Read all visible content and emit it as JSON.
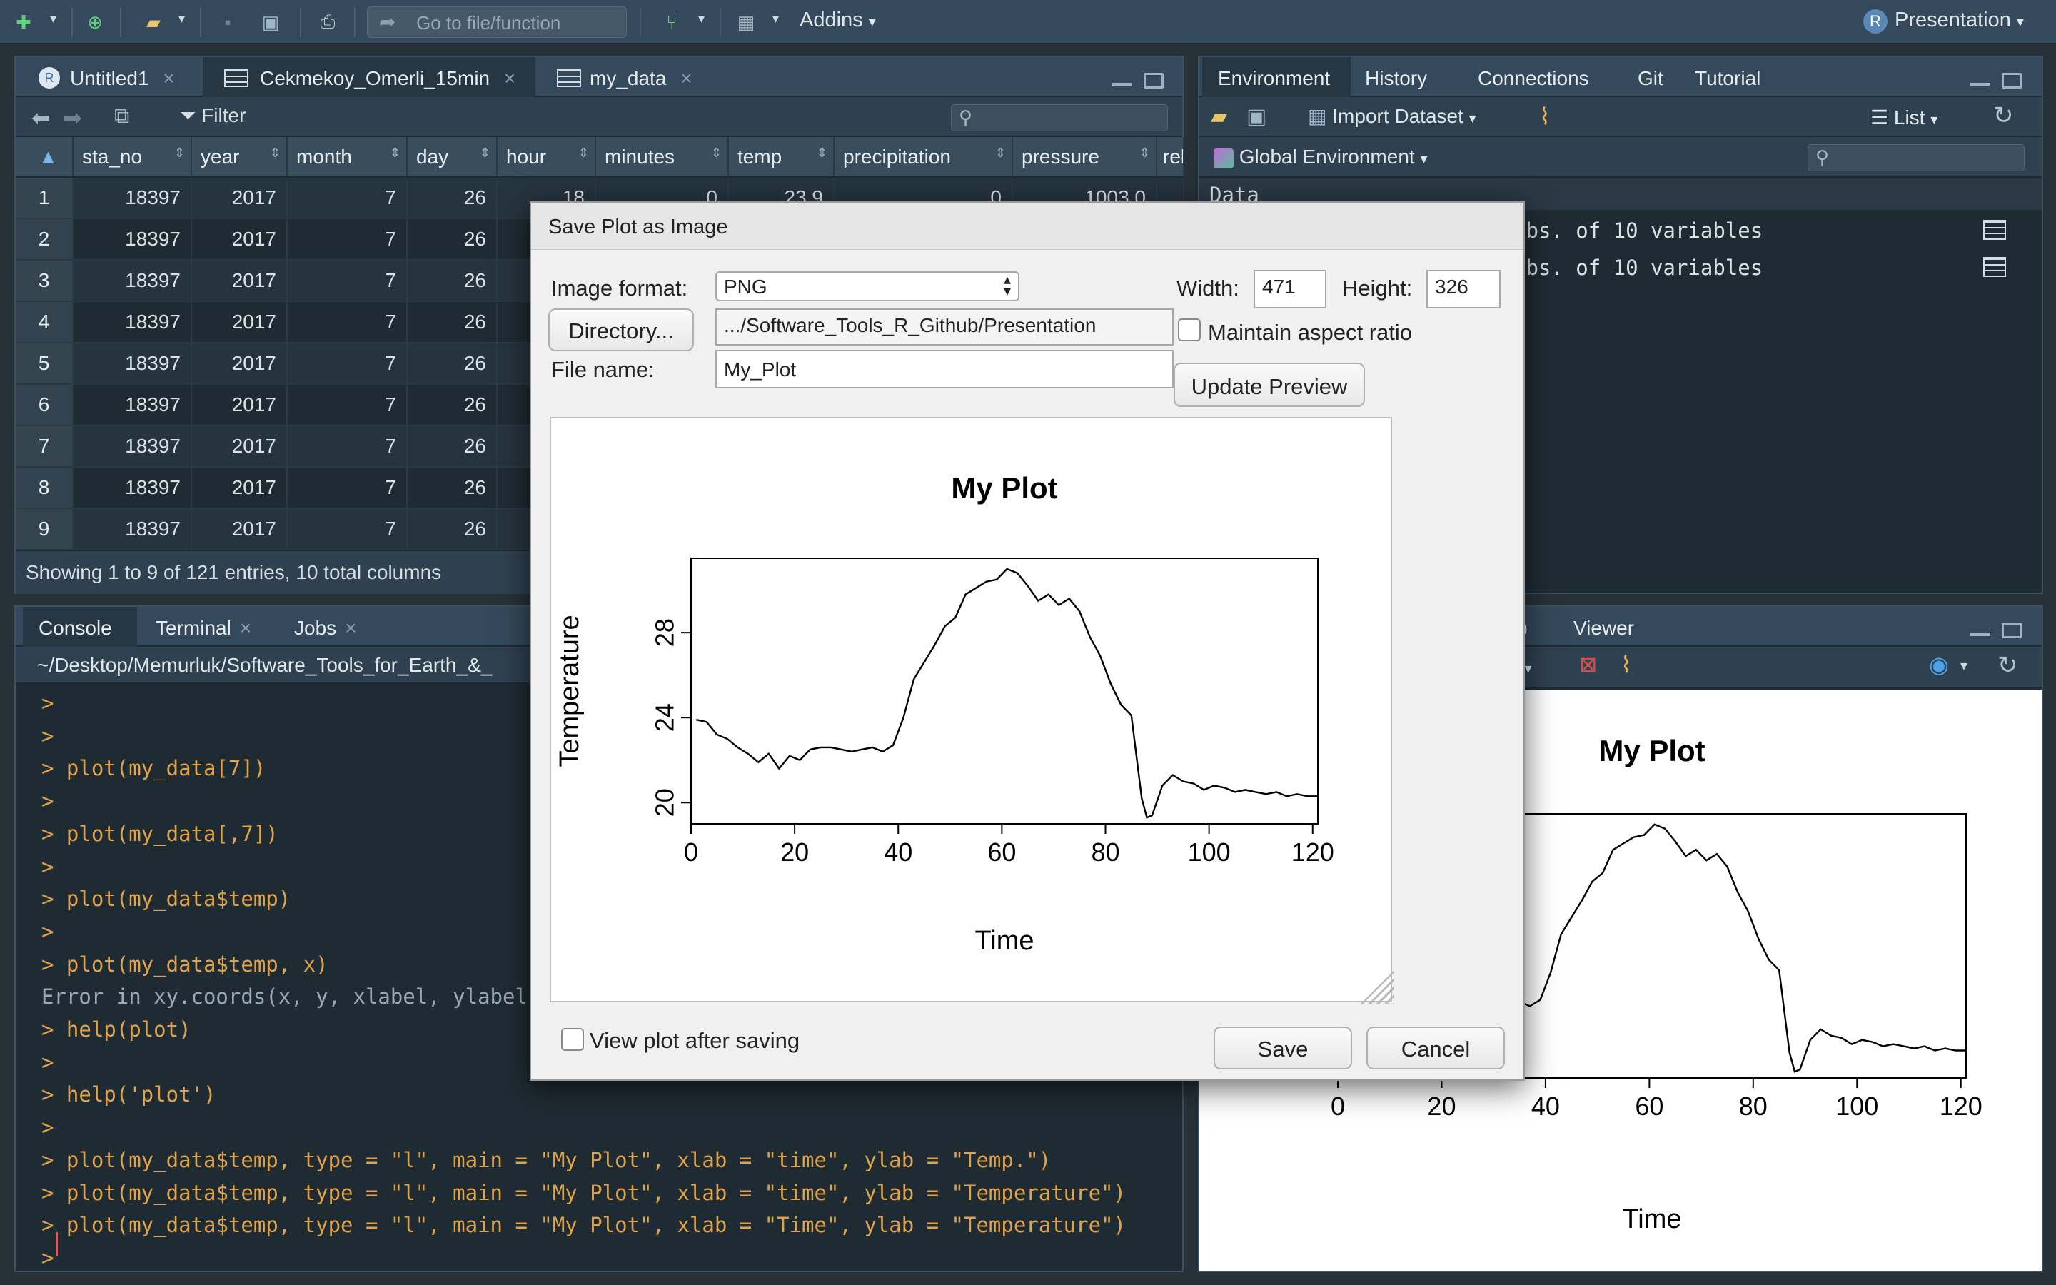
{
  "toolbar": {
    "goto_placeholder": "Go to file/function",
    "addins_label": "Addins",
    "project_label": "Presentation"
  },
  "source_pane": {
    "tabs": [
      {
        "label": "Untitled1"
      },
      {
        "label": "Cekmekoy_Omerli_15min"
      },
      {
        "label": "my_data"
      }
    ],
    "filter_label": "Filter",
    "columns": [
      "sta_no",
      "year",
      "month",
      "day",
      "hour",
      "minutes",
      "temp",
      "precipitation",
      "pressure",
      "rel"
    ],
    "rows": [
      {
        "n": "1",
        "sta_no": "18397",
        "year": "2017",
        "month": "7",
        "day": "26",
        "hour": "18",
        "minutes": "0",
        "temp": "23.9",
        "precipitation": "0",
        "pressure": "1003.0"
      },
      {
        "n": "2",
        "sta_no": "18397",
        "year": "2017",
        "month": "7",
        "day": "26"
      },
      {
        "n": "3",
        "sta_no": "18397",
        "year": "2017",
        "month": "7",
        "day": "26"
      },
      {
        "n": "4",
        "sta_no": "18397",
        "year": "2017",
        "month": "7",
        "day": "26"
      },
      {
        "n": "5",
        "sta_no": "18397",
        "year": "2017",
        "month": "7",
        "day": "26"
      },
      {
        "n": "6",
        "sta_no": "18397",
        "year": "2017",
        "month": "7",
        "day": "26"
      },
      {
        "n": "7",
        "sta_no": "18397",
        "year": "2017",
        "month": "7",
        "day": "26"
      },
      {
        "n": "8",
        "sta_no": "18397",
        "year": "2017",
        "month": "7",
        "day": "26"
      },
      {
        "n": "9",
        "sta_no": "18397",
        "year": "2017",
        "month": "7",
        "day": "26"
      }
    ],
    "status": "Showing 1 to 9 of 121 entries, 10 total columns"
  },
  "console_pane": {
    "tabs": [
      {
        "label": "Console"
      },
      {
        "label": "Terminal"
      },
      {
        "label": "Jobs"
      }
    ],
    "path": "~/Desktop/Memurluk/Software_Tools_for_Earth_&_",
    "lines": [
      {
        "p": ">",
        "c": "",
        "t": "cmd"
      },
      {
        "p": ">",
        "c": "",
        "t": "cmd"
      },
      {
        "p": ">",
        "c": " plot(my_data[7])",
        "t": "cmd"
      },
      {
        "p": ">",
        "c": "",
        "t": "cmd"
      },
      {
        "p": ">",
        "c": " plot(my_data[,7])",
        "t": "cmd"
      },
      {
        "p": ">",
        "c": "",
        "t": "cmd"
      },
      {
        "p": ">",
        "c": " plot(my_data$temp)",
        "t": "cmd"
      },
      {
        "p": ">",
        "c": "",
        "t": "cmd"
      },
      {
        "p": ">",
        "c": " plot(my_data$temp, x)",
        "t": "cmd"
      },
      {
        "p": "",
        "c": "Error in xy.coords(x, y, xlabel, ylabel",
        "t": "err"
      },
      {
        "p": ">",
        "c": " help(plot)",
        "t": "cmd"
      },
      {
        "p": ">",
        "c": "",
        "t": "cmd"
      },
      {
        "p": ">",
        "c": " help('plot')",
        "t": "cmd"
      },
      {
        "p": ">",
        "c": "",
        "t": "cmd"
      },
      {
        "p": ">",
        "c": " plot(my_data$temp, type = \"l\", main = \"My Plot\", xlab = \"time\", ylab = \"Temp.\")",
        "t": "cmd"
      },
      {
        "p": ">",
        "c": " plot(my_data$temp, type = \"l\", main = \"My Plot\", xlab = \"time\", ylab = \"Temperature\")",
        "t": "cmd"
      },
      {
        "p": ">",
        "c": " plot(my_data$temp, type = \"l\", main = \"My Plot\", xlab = \"Time\", ylab = \"Temperature\")",
        "t": "cmd"
      },
      {
        "p": ">",
        "c": "",
        "t": "cmd"
      },
      {
        "p": ">",
        "c": "",
        "t": "cmd"
      }
    ]
  },
  "env_pane": {
    "tabs": [
      {
        "label": "Environment"
      },
      {
        "label": "History"
      },
      {
        "label": "Connections"
      },
      {
        "label": "Git"
      },
      {
        "label": "Tutorial"
      }
    ],
    "import_label": "Import Dataset",
    "list_label": "List",
    "scope_label": "Global Environment",
    "section_label": "Data",
    "vars": [
      {
        "desc": "obs. of 10 variables"
      },
      {
        "desc": "obs. of 10 variables"
      }
    ]
  },
  "viewer_pane": {
    "tabs": [
      {
        "label": "p"
      },
      {
        "label": "Viewer"
      }
    ],
    "export_label": "t"
  },
  "dialog": {
    "title": "Save Plot as Image",
    "image_format_label": "Image format:",
    "image_format_value": "PNG",
    "width_label": "Width:",
    "width_value": "471",
    "height_label": "Height:",
    "height_value": "326",
    "directory_button": "Directory...",
    "directory_path": ".../Software_Tools_R_Github/Presentation",
    "aspect_label": "Maintain aspect ratio",
    "filename_label": "File name:",
    "filename_value": "My_Plot",
    "update_button": "Update Preview",
    "view_after_label": "View plot after saving",
    "save_button": "Save",
    "cancel_button": "Cancel"
  },
  "chart_data": [
    {
      "type": "line",
      "title": "My Plot",
      "xlabel": "Time",
      "ylabel": "Temperature",
      "xlim": [
        0,
        121
      ],
      "ylim": [
        19,
        31.5
      ],
      "xticks": [
        0,
        20,
        40,
        60,
        80,
        100,
        120
      ],
      "yticks": [
        20,
        24,
        28
      ],
      "x": [
        1,
        3,
        5,
        7,
        9,
        11,
        13,
        15,
        17,
        19,
        21,
        23,
        25,
        27,
        29,
        31,
        33,
        35,
        37,
        39,
        41,
        43,
        45,
        47,
        49,
        51,
        53,
        55,
        57,
        59,
        61,
        63,
        65,
        67,
        69,
        71,
        73,
        75,
        77,
        79,
        81,
        83,
        85,
        87,
        88,
        89,
        91,
        93,
        95,
        97,
        99,
        101,
        103,
        105,
        107,
        109,
        111,
        113,
        115,
        117,
        119,
        121
      ],
      "values": [
        23.9,
        23.8,
        23.2,
        23.0,
        22.6,
        22.3,
        21.9,
        22.3,
        21.6,
        22.2,
        22.0,
        22.5,
        22.6,
        22.6,
        22.5,
        22.4,
        22.5,
        22.6,
        22.4,
        22.7,
        24.0,
        25.8,
        26.6,
        27.4,
        28.3,
        28.7,
        29.8,
        30.1,
        30.4,
        30.5,
        31.0,
        30.8,
        30.2,
        29.5,
        29.8,
        29.3,
        29.6,
        29.0,
        27.8,
        26.9,
        25.6,
        24.6,
        24.1,
        20.2,
        19.3,
        19.4,
        20.8,
        21.3,
        21.0,
        20.9,
        20.6,
        20.8,
        20.7,
        20.5,
        20.6,
        20.5,
        20.4,
        20.5,
        20.3,
        20.4,
        20.3,
        20.3
      ]
    }
  ]
}
